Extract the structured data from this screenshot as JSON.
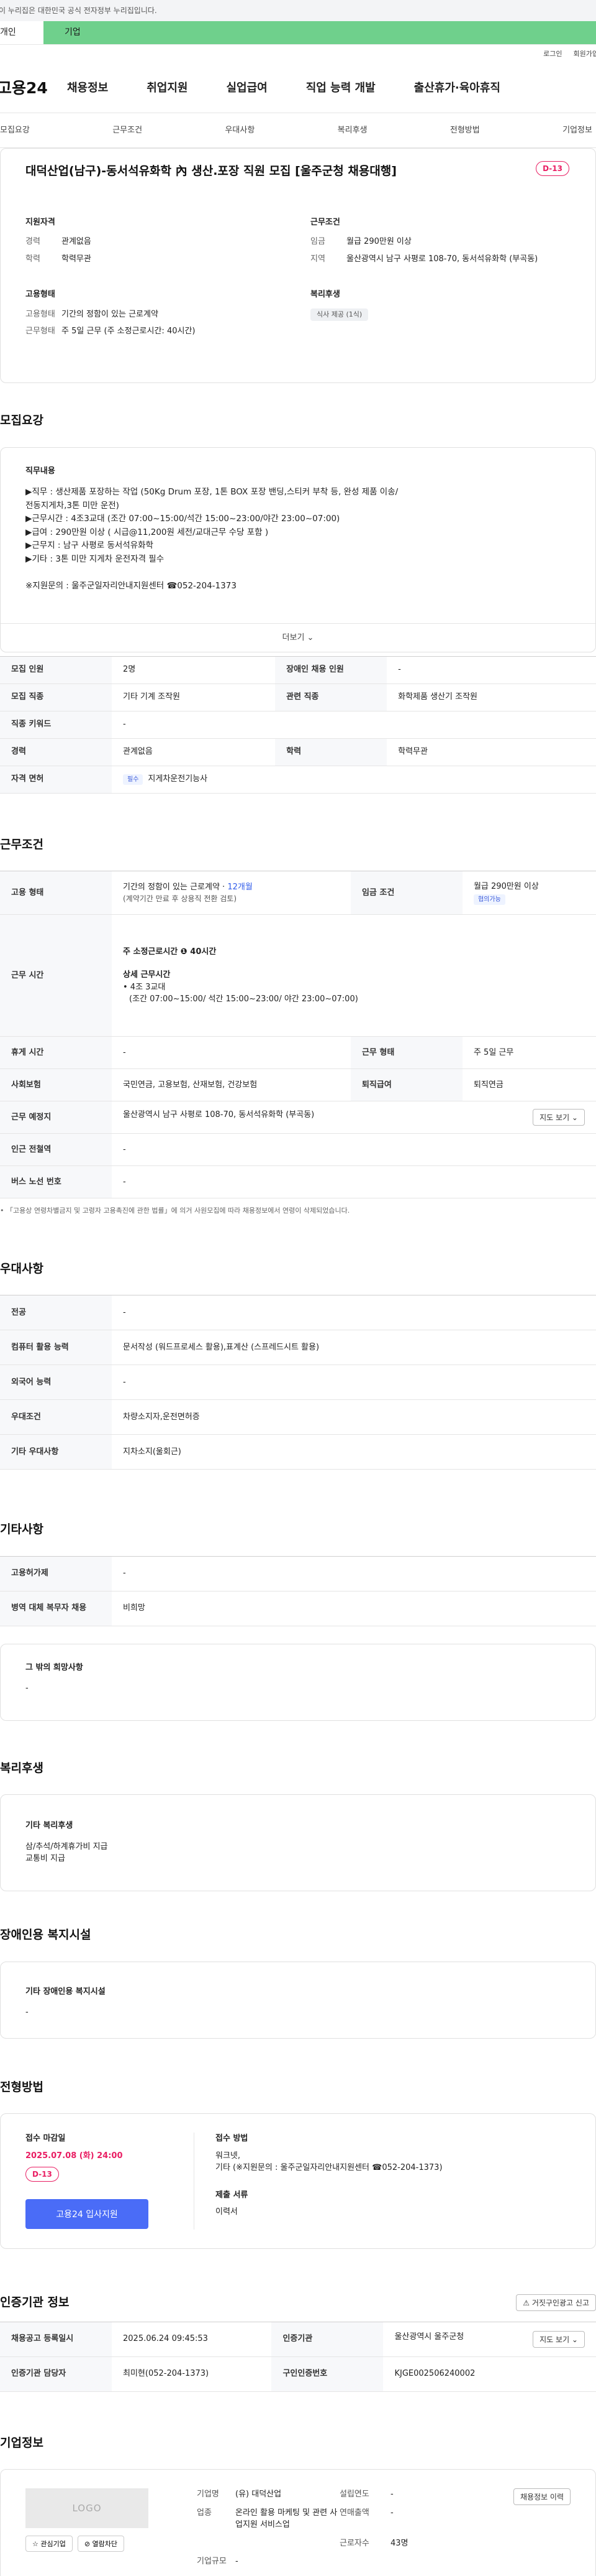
{
  "gov_banner": "이 누리집은 대한민국 공식 전자정부 누리집입니다.",
  "tabs": {
    "person": "개인",
    "company": "기업"
  },
  "util": {
    "login": "로그인",
    "join": "회원가입"
  },
  "logo": "고용24",
  "gnb": [
    "채용정보",
    "취업지원",
    "실업급여",
    "직업 능력 개발",
    "출산휴가·육아휴직"
  ],
  "subnav": [
    "모집요강",
    "근무조건",
    "우대사항",
    "복리후생",
    "전형방법",
    "기업정보"
  ],
  "job": {
    "title": "대덕산업(남구)-동서석유화학 內 생산.포장 직원 모집 [울주군청 채용대행]",
    "dday": "D-13",
    "summary": {
      "qual_head": "지원자격",
      "career_k": "경력",
      "career_v": "관계없음",
      "edu_k": "학력",
      "edu_v": "학력무관",
      "work_head": "근무조건",
      "wage_k": "임금",
      "wage_v": "월급 290만원 이상",
      "loc_k": "지역",
      "loc_v": "울산광역시 남구 사평로 108-70, 동서석유화학 (부곡동)",
      "emp_head": "고용형태",
      "emptype_k": "고용형태",
      "emptype_v": "기간의 정함이 있는 근로계약",
      "worktype_k": "근무형태",
      "worktype_v": "주 5일 근무 (주 소정근로시간: 40시간)",
      "welfare_head": "복리후생",
      "welfare_badge": "식사 제공 (1식)"
    }
  },
  "recruit": {
    "title": "모집요강",
    "duty_title": "직무내용",
    "duty_text": "▶직무 : 생산제품 포장하는 작업 (50Kg Drum 포장, 1톤 BOX 포장 밴딩,스티커 부착 등, 완성 제품 이송/\n    전동지게차,3톤 미만 운전)\n▶근무시간 : 4조3교대  (조간 07:00~15:00/석간 15:00~23:00/야간 23:00~07:00)\n▶급여 : 290만원 이상 ( 시급@11,200원 세전/교대근무 수당 포함 )\n▶근무지 : 남구 사평로 동서석유화학\n▶기타 : 3톤 미만 지게차  운전자격 필수\n\n  ※지원문의 : 울주군일자리안내지원센터  ☎052-204-1373",
    "more": "더보기 ⌄",
    "rows": {
      "headcount_k": "모집 인원",
      "headcount_v": "2명",
      "disabled_k": "장애인 채용 인원",
      "disabled_v": "-",
      "job_k": "모집 직종",
      "job_v": "기타 기계 조작원",
      "rel_k": "관련 직종",
      "rel_v": "화학제품 생산기 조작원",
      "kw_k": "직종 키워드",
      "kw_v": "-",
      "career_k": "경력",
      "career_v": "관계없음",
      "edu_k": "학력",
      "edu_v": "학력무관",
      "lic_k": "자격 면허",
      "lic_pill": "필수",
      "lic_v": "지게차운전기능사"
    }
  },
  "work": {
    "title": "근무조건",
    "emp_k": "고용 형태",
    "emp_v1": "기간의 정함이 있는 근로계약 · ",
    "emp_v1b": "12개월",
    "emp_v2": "(계약기간 만료 후 상용직 전환 검토)",
    "wage_k": "임금 조건",
    "wage_v": "월급 290만원 이상",
    "wage_pill": "협의가능",
    "time_k": "근무 시간",
    "time_v1": "주 소정근로시간 ❶ 40시간",
    "time_v2": "상세 근무시간",
    "time_v3": "• 4조 3교대",
    "time_v4": "(조간 07:00~15:00/ 석간 15:00~23:00/ 야간 23:00~07:00)",
    "rest_k": "휴게 시간",
    "rest_v": "-",
    "form_k": "근무 형태",
    "form_v": "주 5일 근무",
    "ins_k": "사회보험",
    "ins_v": "국민연금, 고용보험, 산재보험, 건강보험",
    "ret_k": "퇴직급여",
    "ret_v": "퇴직연금",
    "place_k": "근무 예정지",
    "place_v": "울산광역시 남구 사평로 108-70, 동서석유화학 (부곡동)",
    "map_btn": "지도 보기 ⌄",
    "sub_k": "인근 전철역",
    "sub_v": "-",
    "bus_k": "버스 노선 번호",
    "bus_v": "-",
    "note": "• 「고용상 연령차별금지 및 고령자 고용촉진에 관한 법률」에 의거 사원모집에 따라 채용정보에서 연령이 삭제되었습니다."
  },
  "pref": {
    "title": "우대사항",
    "major_k": "전공",
    "major_v": "-",
    "pc_k": "컴퓨터 활용 능력",
    "pc_v": "문서작성 (워드프로세스 활용),표계산 (스프레드시트 활용)",
    "lang_k": "외국어 능력",
    "lang_v": "-",
    "cond_k": "우대조건",
    "cond_v": "차량소지자,운전면허증",
    "etc_k": "기타 우대사항",
    "etc_v": "지차소지(울회근)"
  },
  "etc": {
    "title": "기타사항",
    "emp_ins_k": "고용허가제",
    "emp_ins_v": "-",
    "mil_k": "병역 대체 복무자 채용",
    "mil_v": "비희망",
    "hope_k": "그 밖의 희망사항",
    "hope_v": "-"
  },
  "welfare": {
    "title": "복리후생",
    "k": "기타 복리후생",
    "v1": "삼/추석/하계휴가비 지급",
    "v2": "교통비 지급"
  },
  "disabled": {
    "title": "장애인용 복지시설",
    "k": "기타 장애인용 복지시설",
    "v": "-"
  },
  "apply": {
    "title": "전형방법",
    "deadline_k": "접수 마감일",
    "deadline_v": "2025.07.08 (화) 24:00",
    "dday": "D-13",
    "btn": "고용24 입사지원",
    "method_k": "접수 방법",
    "method_v1": "워크넷,",
    "method_v2": "기타 (※지원문의 : 울주군일자리안내지원센터  ☎052-204-1373)",
    "docs_k": "제출 서류",
    "docs_v": "이력서"
  },
  "cert": {
    "title": "인증기관 정보",
    "report_btn": "⚠ 거짓구인광고 신고",
    "reg_k": "채용공고 등록일시",
    "reg_v": "2025.06.24 09:45:53",
    "org_k": "인증기관",
    "org_v": "울산광역시 울주군청",
    "map_btn": "지도 보기 ⌄",
    "mgr_k": "인증기관 담당자",
    "mgr_v": "최미현(052-204-1373)",
    "num_k": "구인인증번호",
    "num_v": "KJGE002506240002"
  },
  "company": {
    "title": "기업정보",
    "logo": "LOGO",
    "fav": "☆ 관심기업",
    "block": "⊘ 열람차단",
    "name_k": "기업명",
    "name_v": "(유) 대덕산업",
    "year_k": "설립연도",
    "year_v": "-",
    "biz_k": "업종",
    "biz_v": "온라인 활용 마케팅 및 관련 사업지원 서비스업",
    "sales_k": "연매출액",
    "sales_v": "-",
    "emp_k": "근로자수",
    "emp_v": "43명",
    "size_k": "기업규모",
    "size_v": "-",
    "jobs_btn": "채용정보 이력"
  }
}
